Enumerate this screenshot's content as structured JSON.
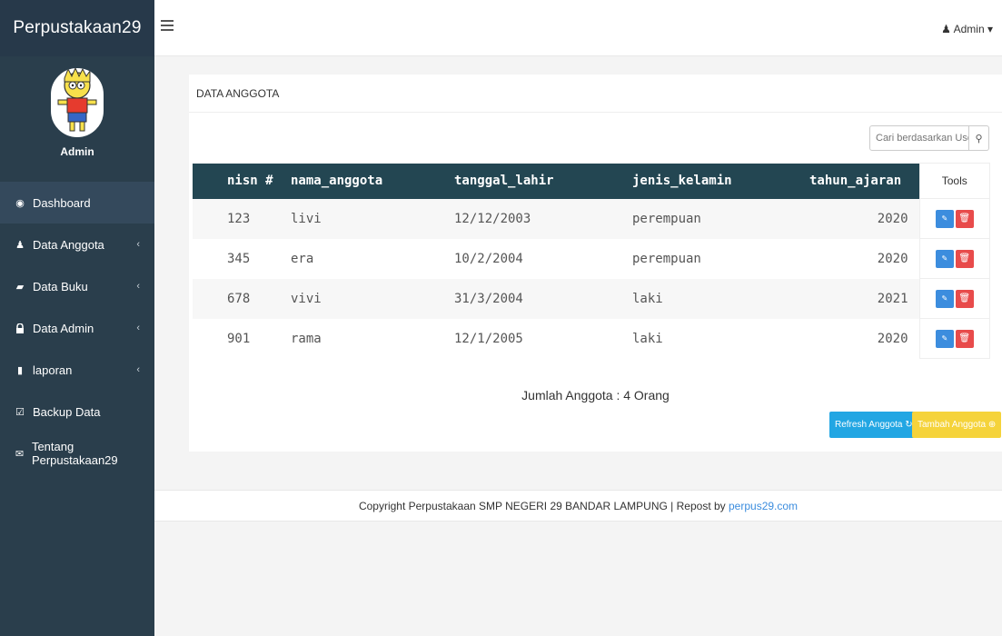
{
  "sidebar": {
    "brand": "Perpustakaan29",
    "profile_name": "Admin",
    "items": [
      {
        "label": "Dashboard",
        "icon": "dashboard-icon",
        "glyph": "◉"
      },
      {
        "label": "Data Anggota",
        "icon": "user-icon",
        "glyph": "♟"
      },
      {
        "label": "Data Buku",
        "icon": "book-icon",
        "glyph": "▰"
      },
      {
        "label": "Data Admin",
        "icon": "lock-icon",
        "glyph": "🔒"
      },
      {
        "label": "laporan",
        "icon": "file-icon",
        "glyph": "▮"
      },
      {
        "label": "Backup Data",
        "icon": "checkbox-icon",
        "glyph": "☑"
      },
      {
        "label": "Tentang Perpustakaan29",
        "icon": "envelope-icon",
        "glyph": "✉"
      }
    ]
  },
  "topbar": {
    "user_label": "Admin"
  },
  "panel": {
    "heading": "DATA ANGGOTA",
    "search_placeholder": "Cari berdasarkan User ID",
    "table": {
      "headers": [
        "nisn #",
        "nama_anggota",
        "tanggal_lahir",
        "jenis_kelamin",
        "tahun_ajaran",
        "Tools"
      ],
      "rows": [
        {
          "nisn": "123",
          "nama": "livi",
          "tgl": "12/12/2003",
          "jk": "perempuan",
          "ta": "2020"
        },
        {
          "nisn": "345",
          "nama": "era",
          "tgl": "10/2/2004",
          "jk": "perempuan",
          "ta": "2020"
        },
        {
          "nisn": "678",
          "nama": "vivi",
          "tgl": "31/3/2004",
          "jk": "laki",
          "ta": "2021"
        },
        {
          "nisn": "901",
          "nama": "rama",
          "tgl": "12/1/2005",
          "jk": "laki",
          "ta": "2020"
        }
      ]
    },
    "summary": "Jumlah Anggota : 4 Orang",
    "refresh_label": "Refresh Anggota",
    "add_label": "Tambah Anggota"
  },
  "footer": {
    "text": "Copyright Perpustakaan SMP NEGERI 29 BANDAR LAMPUNG | Repost by ",
    "link": "perpus29.com"
  },
  "colors": {
    "sidebar": "#2a3e4c",
    "table_header": "#234652",
    "edit": "#3c8dde",
    "delete": "#e84b4b",
    "refresh": "#22a6e3",
    "add": "#f5d33b"
  }
}
